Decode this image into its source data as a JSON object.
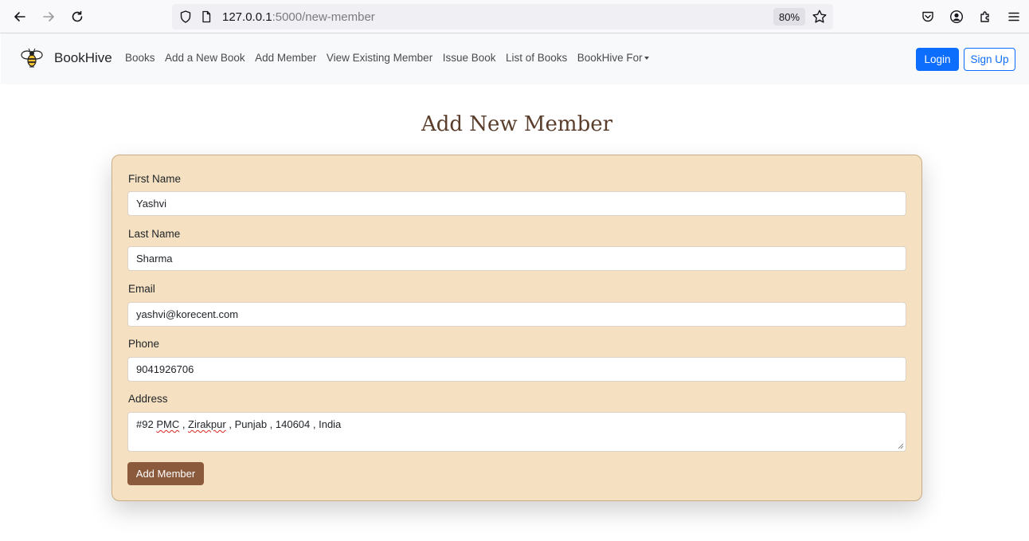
{
  "browser": {
    "url_host": "127.0.0.1",
    "url_path": ":5000/new-member",
    "zoom": "80%"
  },
  "navbar": {
    "brand": "BookHive",
    "links": [
      "Books",
      "Add a New Book",
      "Add Member",
      "View Existing Member",
      "Issue Book",
      "List of Books"
    ],
    "dropdown_label": "BookHive For",
    "login_label": "Login",
    "signup_label": "Sign Up",
    "login_color": "#0d6efd"
  },
  "page": {
    "title": "Add New Member"
  },
  "form": {
    "first_name": {
      "label": "First Name",
      "value": "Yashvi"
    },
    "last_name": {
      "label": "Last Name",
      "value": "Sharma"
    },
    "email": {
      "label": "Email",
      "value": "yashvi@korecent.com"
    },
    "phone": {
      "label": "Phone",
      "value": "9041926706"
    },
    "address": {
      "label": "Address",
      "value_parts": [
        "#92 ",
        "PMC",
        " , ",
        "Zirakpur",
        " , Punjab , 140604 , India"
      ]
    },
    "submit_label": "Add Member",
    "card_color": "#f5e1c1",
    "button_color": "#8b5a3c"
  }
}
